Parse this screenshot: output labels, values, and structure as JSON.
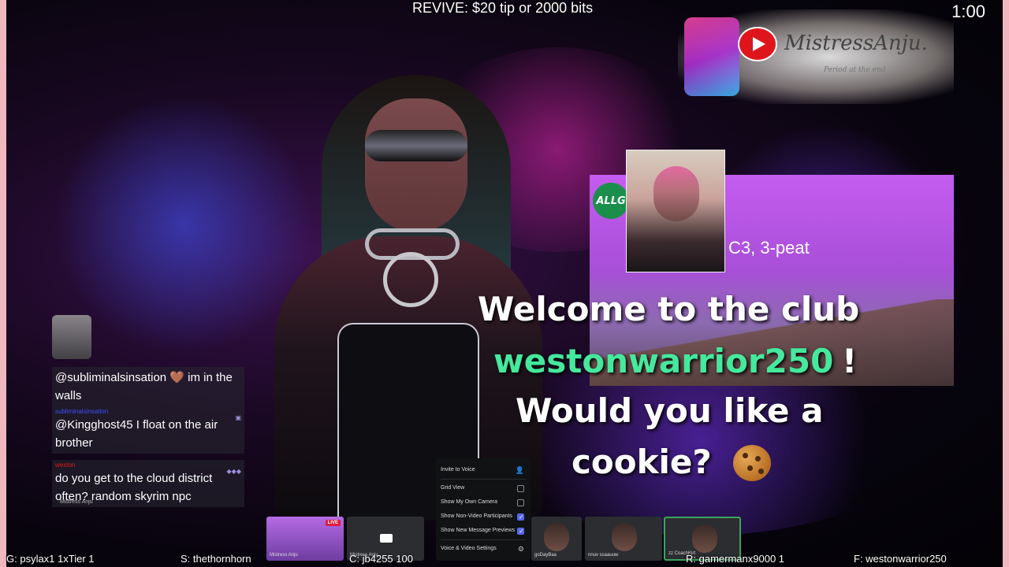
{
  "top": {
    "revive_text": "REVIVE: $20 tip or 2000 bits",
    "timer": "1:00"
  },
  "brand": {
    "name": "MistressAnju.",
    "tagline": "Period at the end",
    "icon": "youtube-icon"
  },
  "alert": {
    "logo_text": "ALLG",
    "subscriber_name": "C3, 3-peat",
    "line1": "Welcome to the club",
    "username": "westonwarrior250",
    "exclaim": "!",
    "line2": "Would you like a",
    "line3": "cookie?",
    "emoji": "cookie-icon"
  },
  "chat": {
    "messages": [
      {
        "text": "@subliminalsinsation 🤎 im in the walls",
        "sender": ""
      },
      {
        "text": "@Kingghost45 I float on the air brother",
        "sender": "subliminalsinsation"
      },
      {
        "text": "do you get to the cloud district often? random skyrim npc",
        "sender": "weston"
      }
    ],
    "footer": "Mistress Anju"
  },
  "voice_menu": {
    "items": [
      {
        "label": "Invite to Voice",
        "kind": "icon",
        "checked": false
      },
      {
        "label": "Grid View",
        "kind": "checkbox",
        "checked": false
      },
      {
        "label": "Show My Own Camera",
        "kind": "checkbox",
        "checked": false
      },
      {
        "label": "Show Non-Video Participants",
        "kind": "checkbox",
        "checked": true
      },
      {
        "label": "Show New Message Previews",
        "kind": "checkbox",
        "checked": true
      },
      {
        "label": "Voice & Video Settings",
        "kind": "icon",
        "checked": false
      }
    ]
  },
  "participants": [
    {
      "label": "Mistress Anju",
      "live": "LIVE"
    },
    {
      "label": "Mistress Anju"
    },
    {
      "label": "goDayBaa"
    },
    {
      "label": "nnuv ssaauuw"
    },
    {
      "label": "zz CoachKirt"
    }
  ],
  "bottom_bar": {
    "g": "G: psylax1 1xTier 1",
    "s": "S: thethornhorn",
    "c": "C: jb4255 100",
    "r": "R: gamermanx9000 1",
    "f": "F: westonwarrior250"
  }
}
